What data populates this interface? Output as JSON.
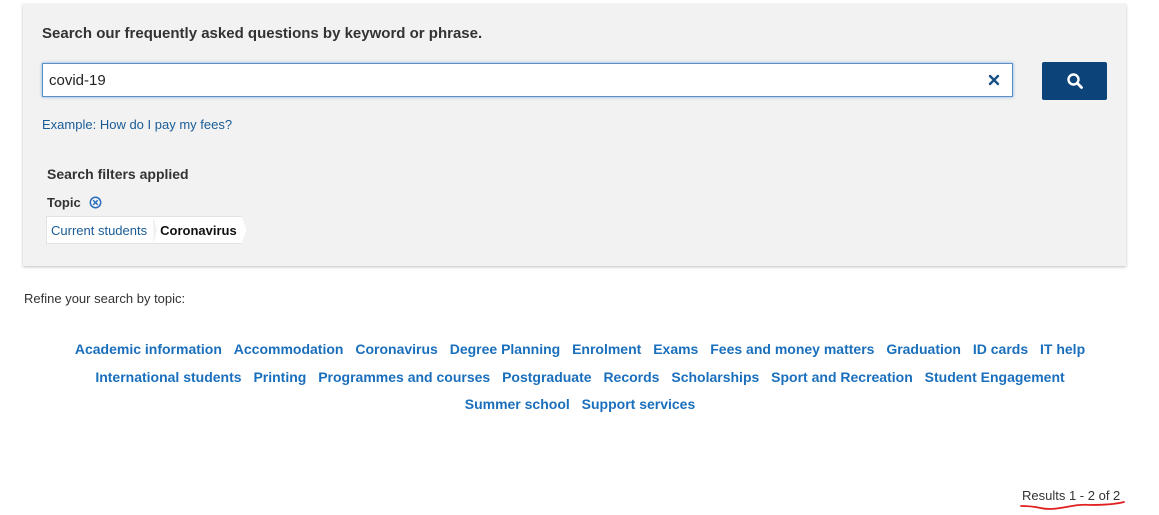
{
  "search": {
    "heading": "Search our frequently asked questions by keyword or phrase.",
    "value": "covid-19",
    "clear_icon": "close-icon",
    "button_icon": "search-icon",
    "example_prefix": "Example:",
    "example_text": "How do I pay my fees?"
  },
  "filters": {
    "heading": "Search filters applied",
    "topic_label": "Topic",
    "remove_icon": "remove-circle-icon",
    "breadcrumb": {
      "parent": "Current students",
      "current": "Coronavirus"
    }
  },
  "refine": {
    "label": "Refine your search by topic:",
    "topics": [
      "Academic information",
      "Accommodation",
      "Coronavirus",
      "Degree Planning",
      "Enrolment",
      "Exams",
      "Fees and money matters",
      "Graduation",
      "ID cards",
      "IT help",
      "International students",
      "Printing",
      "Programmes and courses",
      "Postgraduate",
      "Records",
      "Scholarships",
      "Sport and Recreation",
      "Student Engagement",
      "Summer school",
      "Support services"
    ]
  },
  "results": {
    "text": "Results 1 - 2 of 2"
  },
  "colors": {
    "panel_bg": "#f2f2f2",
    "primary_button": "#0c4379",
    "link": "#1a5c97",
    "topic_link": "#1a6fbd",
    "annotation_red": "#e02020"
  }
}
